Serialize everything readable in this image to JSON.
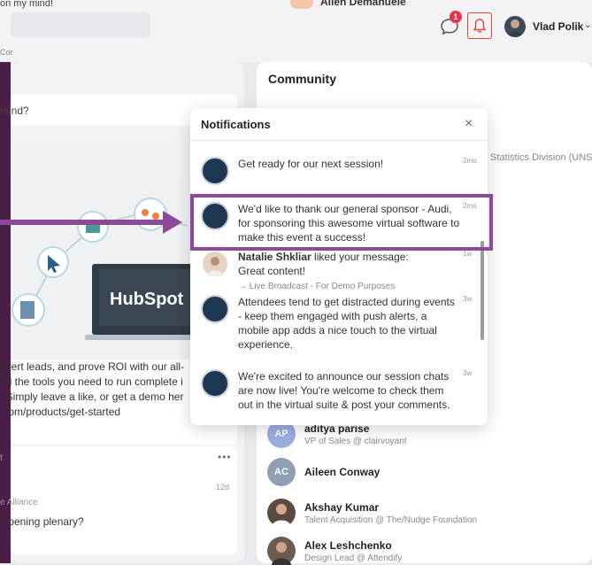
{
  "topbar": {
    "peek_left_text": "on my mind!",
    "peek_right_name": "Allen Demanuele",
    "co_text": "Cor",
    "chat_badge": "1",
    "user_name": "Vlad Polik"
  },
  "feed": {
    "post_placeholder": "mind?",
    "hubspot_logo": "HubSpot",
    "body_lines": [
      "nvert leads, and prove ROI with our all-",
      "All the tools you need to run complete i",
      ". Simply leave a like, or get a demo her",
      ".com/products/get-started"
    ],
    "small_card": {
      "head": "t",
      "time": "12d",
      "source": "e Alliance",
      "question": "Opening plenary?"
    }
  },
  "community": {
    "title": "Community",
    "statistics_peek": "Statistics Division (UNS...",
    "members": [
      {
        "initials": "AP",
        "name": "aditya parise",
        "role": "VP of Sales @ clairvoyant",
        "color": "#9aaee0"
      },
      {
        "initials": "AC",
        "name": "Aileen Conway",
        "role": "",
        "color": "#8fa0b3"
      },
      {
        "initials": "",
        "name": "Akshay Kumar",
        "role": "Talent Acquisition @ The/Nudge Foundation",
        "color": "#5b4a3f"
      },
      {
        "initials": "",
        "name": "Alex Leshchenko",
        "role": "Design Lead @ Attendify",
        "color": "#6d5b50"
      }
    ]
  },
  "notifications": {
    "title": "Notifications",
    "close": "×",
    "items": [
      {
        "text": "Get ready for our next session!",
        "time": "2mo"
      },
      {
        "text": "We'd like to thank our general sponsor - Audi, for sponsoring this awesome virtual software to make this event a success!",
        "time": "2mo"
      },
      {
        "author": "Natalie Shkliar",
        "action": " liked your message:",
        "message": "Great content!",
        "sub": "→  Live Broadcast - For Demo Purposes",
        "time": "1w"
      },
      {
        "text": "Attendees tend to get distracted during events - keep them engaged with push alerts, a mobile app adds a nice touch to the virtual experience.",
        "time": "3w"
      },
      {
        "text": "We're excited to announce our session chats are now live! You're welcome to check them out in the virtual suite & post your comments.",
        "time": "3w"
      }
    ]
  },
  "colors": {
    "accent_purple": "#8c4a99",
    "bell_border": "#e0453b",
    "badge": "#e5334b"
  }
}
